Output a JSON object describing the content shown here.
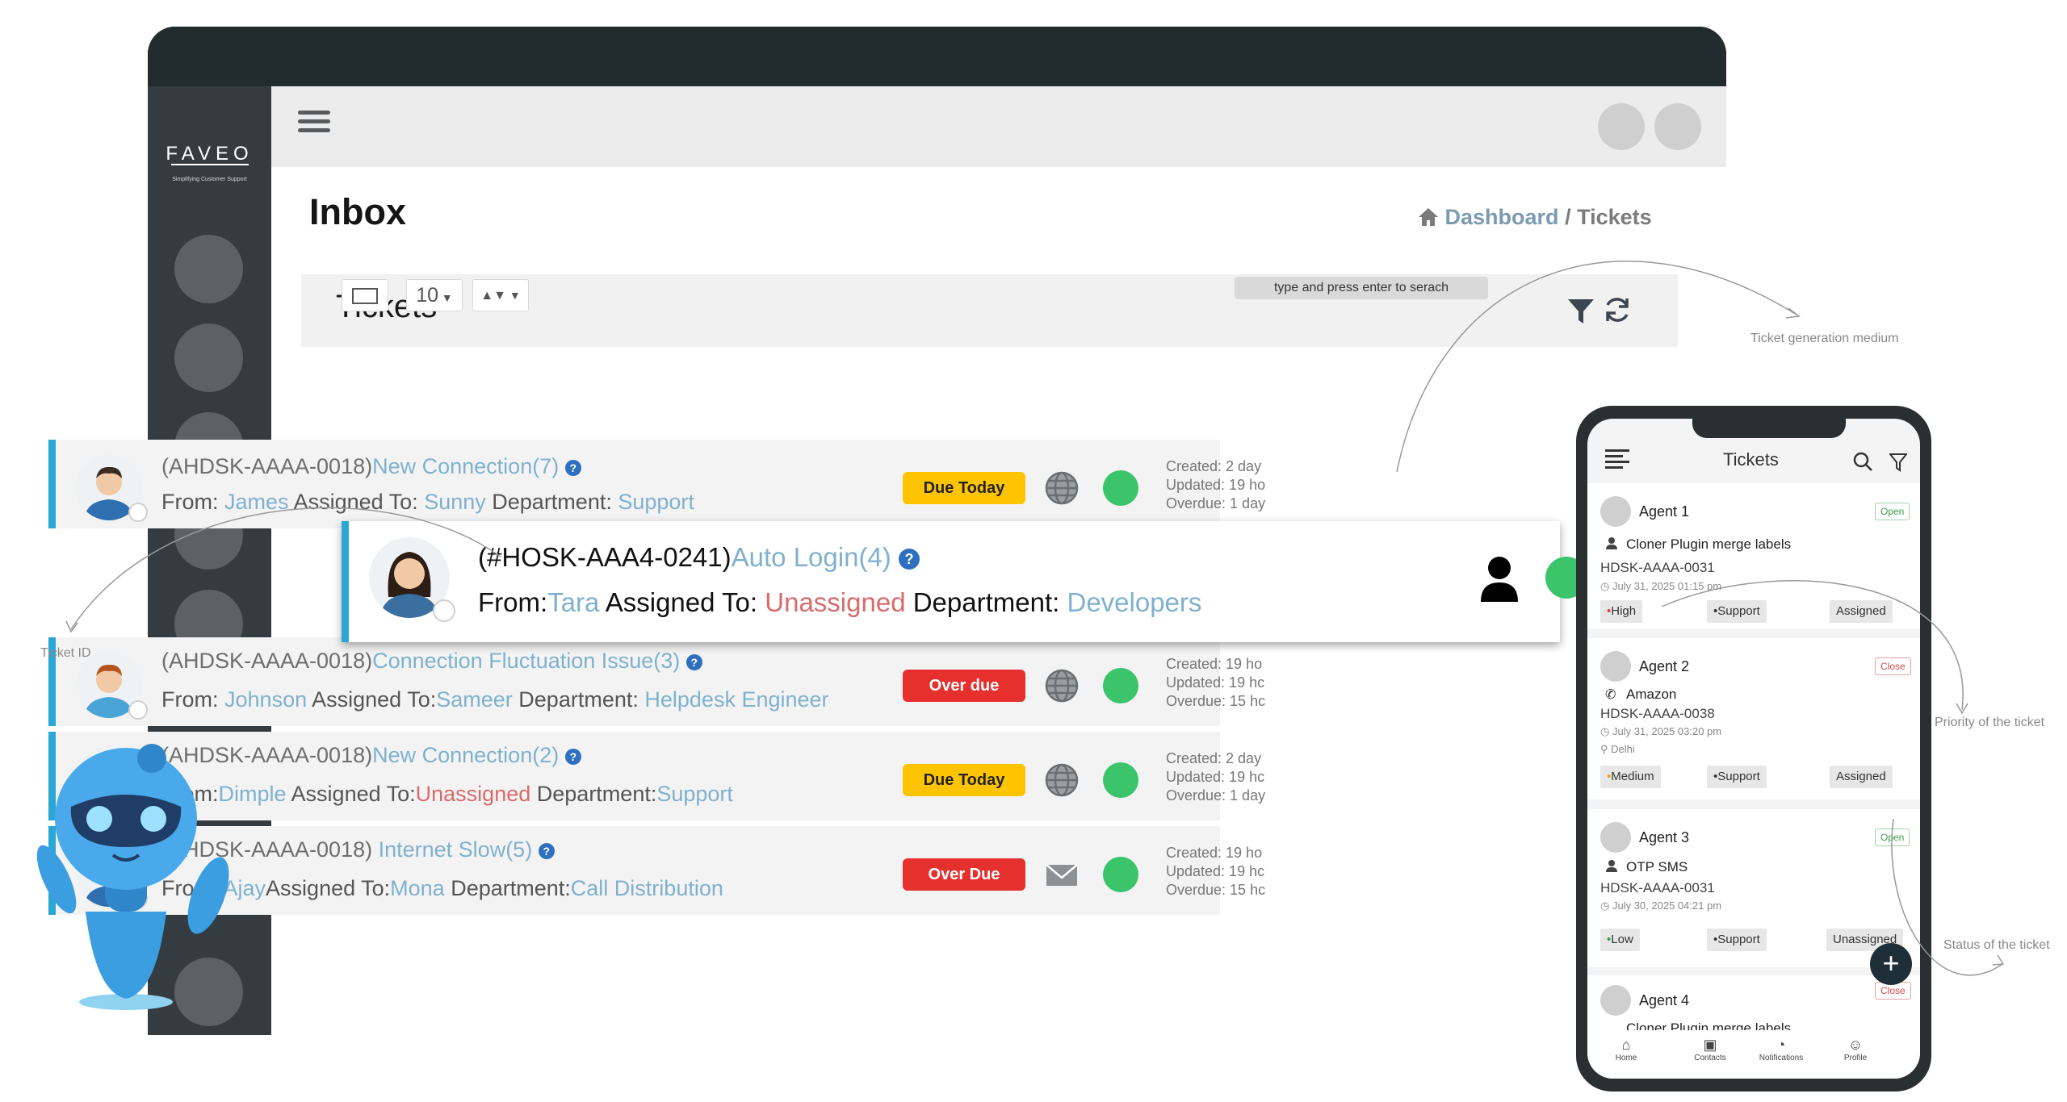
{
  "brand": {
    "name": "FAVEO",
    "tagline": "Simplifying Customer Support"
  },
  "page": {
    "title": "Inbox"
  },
  "breadcrumb": {
    "home": "Dashboard",
    "separator": "/",
    "current": "Tickets"
  },
  "tickets_panel": {
    "title": "Tickets",
    "page_size": "10",
    "search_placeholder": "type and press enter to serach"
  },
  "tickets": [
    {
      "id": "(AHDSK-AAAA-0018)",
      "subject": "New Connection(7)",
      "from_label": "From:",
      "from": "James",
      "assigned_label": "Assigned To:",
      "assigned": "Sunny",
      "dept_label": "Department:",
      "dept": "Support",
      "due": "Due Today",
      "created": "Created: 2 day",
      "updated": "Updated: 19 ho",
      "overdue": "Overdue: 1 day"
    },
    {
      "id": "(#HOSK-AAA4-0241)",
      "subject": "Auto Login(4)",
      "from_label": "From:",
      "from": "Tara",
      "assigned_label": "Assigned To:",
      "assigned": "Unassigned",
      "dept_label": "Department:",
      "dept": "Developers"
    },
    {
      "id": "(AHDSK-AAAA-0018)",
      "subject": "Connection Fluctuation Issue(3)",
      "from_label": "From:",
      "from": "Johnson",
      "assigned_label": "Assigned To:",
      "assigned": "Sameer",
      "dept_label": "Department:",
      "dept": "Helpdesk Engineer",
      "due": "Over due",
      "created": "Created: 19 ho",
      "updated": "Updated: 19 hc",
      "overdue": "Overdue: 15 hc"
    },
    {
      "id": "(AHDSK-AAAA-0018)",
      "subject": "New Connection(2)",
      "from_label": "From:",
      "from": "Dimple",
      "assigned_label": "Assigned To:",
      "assigned": "Unassigned",
      "dept_label": "Department:",
      "dept": "Support",
      "due": "Due Today",
      "created": "Created: 2 day",
      "updated": "Updated: 19 hc",
      "overdue": "Overdue: 1 day"
    },
    {
      "id": "(AHDSK-AAAA-0018)",
      "subject": "Internet Slow(5)",
      "from_label": "From:",
      "from": "Ajay",
      "assigned_label": "Assigned To:",
      "assigned": "Mona",
      "dept_label": "Department:",
      "dept": "Call Distribution",
      "due": "Over Due",
      "created": "Created: 19 ho",
      "updated": "Updated: 19 hc",
      "overdue": "Overdue: 15 hc"
    }
  ],
  "phone": {
    "title": "Tickets",
    "cards": [
      {
        "agent": "Agent 1",
        "status": "Open",
        "subject": "Cloner Plugin merge labels",
        "id": "HDSK-AAAA-0031",
        "date": "July 31, 2025 01:15 pm",
        "priority": "High",
        "dept": "Support",
        "assign": "Assigned"
      },
      {
        "agent": "Agent 2",
        "status": "Close",
        "subject": "Amazon",
        "id": "HDSK-AAAA-0038",
        "date": "July 31, 2025 03:20 pm",
        "location": "Delhi",
        "priority": "Medium",
        "dept": "Support",
        "assign": "Assigned"
      },
      {
        "agent": "Agent 3",
        "status": "Open",
        "subject": "OTP SMS",
        "id": "HDSK-AAAA-0031",
        "date": "July 30, 2025 04:21 pm",
        "priority": "Low",
        "dept": "Support",
        "assign": "Unassigned"
      },
      {
        "agent": "Agent 4",
        "status": "Close",
        "subject": "Cloner Plugin merge labels"
      }
    ],
    "tabs": [
      "Home",
      "Contacts",
      "Notifications",
      "Profile"
    ]
  },
  "annotations": {
    "medium": "Ticket generation medium",
    "ticket_id": "Ticket ID",
    "priority": "Priority of the ticket",
    "status": "Status of the ticket"
  },
  "colors": {
    "accent": "#2aa7d5",
    "link": "#7fb1cf",
    "due_today": "#ffc400",
    "over_due": "#e6302d",
    "clock": "#3bc46a"
  }
}
